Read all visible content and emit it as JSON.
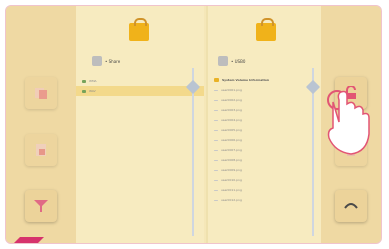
{
  "left_panel": {
    "path_label": "• Share",
    "items": [
      {
        "label": "WMA",
        "selected": false
      },
      {
        "label": "WAV",
        "selected": true
      }
    ]
  },
  "right_panel": {
    "path_label": "• USB0",
    "items": [
      {
        "label": "System Volume Information",
        "type": "folder"
      },
      {
        "label": "user0001.png",
        "type": "file"
      },
      {
        "label": "user0002.png",
        "type": "file"
      },
      {
        "label": "user0003.png",
        "type": "file"
      },
      {
        "label": "user0004.png",
        "type": "file"
      },
      {
        "label": "user0005.png",
        "type": "file"
      },
      {
        "label": "user0006.png",
        "type": "file"
      },
      {
        "label": "user0007.png",
        "type": "file"
      },
      {
        "label": "user0008.png",
        "type": "file"
      },
      {
        "label": "user0009.png",
        "type": "file"
      },
      {
        "label": "user0010.png",
        "type": "file"
      },
      {
        "label": "user0011.png",
        "type": "file"
      },
      {
        "label": "user0012.png",
        "type": "file"
      }
    ]
  },
  "colors": {
    "background": "#f5e7b8",
    "folder": "#f0b21a",
    "accent": "#d6336c"
  }
}
